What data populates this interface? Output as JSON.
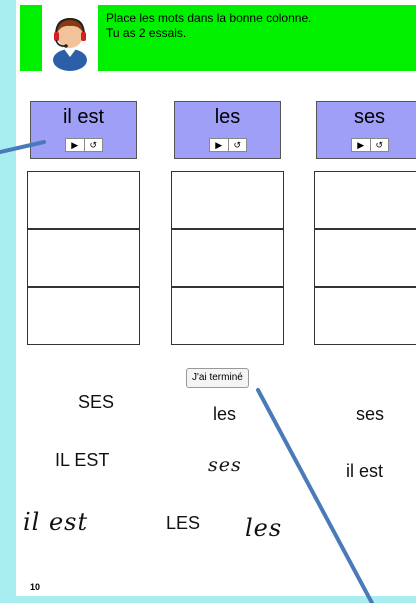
{
  "instructions": {
    "line1": "Place les mots dans la bonne colonne.",
    "line2": "Tu as 2 essais."
  },
  "columns": [
    {
      "title": "il est"
    },
    {
      "title": "les"
    },
    {
      "title": "ses"
    }
  ],
  "audio": {
    "play_glyph": "▶",
    "replay_glyph": "↺"
  },
  "done_button": "J'ai terminé",
  "words": [
    "SES",
    "les",
    "ses",
    "IL EST",
    "ses",
    "il est",
    "il est",
    "LES",
    "les"
  ],
  "page_number": "10",
  "colors": {
    "border_accent": "#a8eef0",
    "header_bg": "#00f000",
    "column_header_bg": "#9f9ff7",
    "pointer_line": "#4a7ab8"
  }
}
